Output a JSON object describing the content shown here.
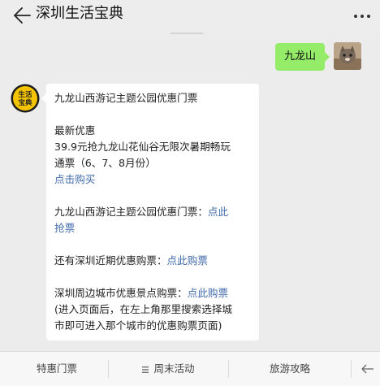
{
  "header": {
    "title": "深圳生活宝典"
  },
  "outgoing": {
    "text": "九龙山"
  },
  "incoming": {
    "line1": "九龙山西游记主题公园优惠门票",
    "line2": "最新优惠",
    "line3": "39.9元抢九龙山花仙谷无限次暑期畅玩",
    "line4": "通票（6、7、8月份）",
    "link1": "点击购买",
    "line5": "九龙山西游记主题公园优惠门票：",
    "link2": "点此",
    "link2b": "抢票",
    "line6": "还有深圳近期优惠购票：",
    "link3": "点此购票",
    "line7": "深圳周边城市优惠景点购票：",
    "link4": "点此购票",
    "line8": "(进入页面后，在左上角那里搜索选择城",
    "line9": "市即可进入那个城市的优惠购票页面)"
  },
  "avatar_left_text": {
    "top": "生活",
    "bottom": "宝典"
  },
  "menu": {
    "items": [
      "特惠门票",
      "周末活动",
      "旅游攻略"
    ]
  },
  "colors": {
    "accent_green": "#95ec69",
    "link": "#3f6aa8",
    "logo_yellow": "#f5c400"
  }
}
